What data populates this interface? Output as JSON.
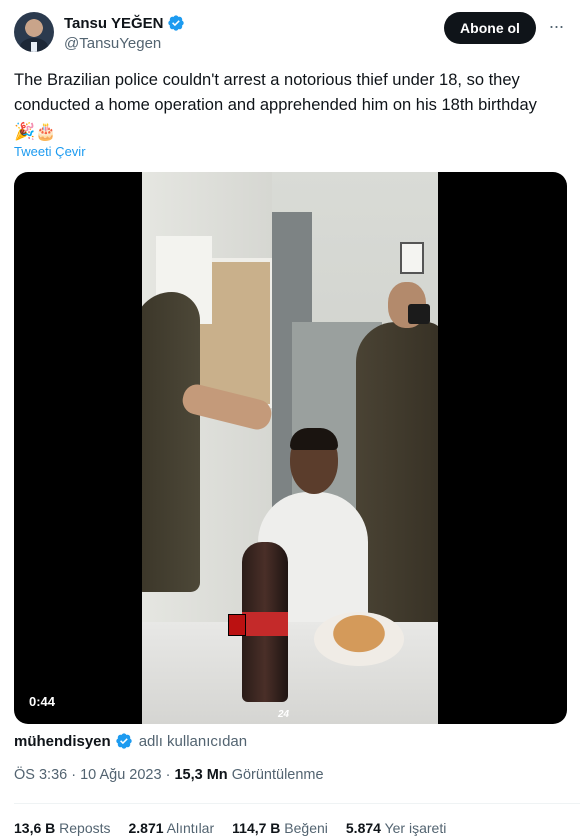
{
  "author": {
    "display_name": "Tansu YEĞEN",
    "handle": "@TansuYegen",
    "verified_color": "#1d9bf0"
  },
  "follow_button": {
    "label": "Abone ol"
  },
  "more_icon": "more-horizontal-icon",
  "tweet": {
    "text": "The Brazilian police couldn't arrest a notorious thief under 18, so they conducted a home operation and apprehended him on his 18th birthday",
    "emojis": [
      "🎉",
      "🎂"
    ]
  },
  "translate_link": "Tweeti Çevir",
  "video": {
    "duration": "0:44",
    "watermark": "24"
  },
  "attribution": {
    "name": "mühendisyen",
    "suffix": "adlı kullanıcıdan"
  },
  "meta": {
    "time": "ÖS 3:36",
    "separator": "·",
    "date": "10 Ağu 2023",
    "views_count": "15,3 Mn",
    "views_label": "Görüntülenme"
  },
  "stats": {
    "reposts_count": "13,6 B",
    "reposts_label": "Reposts",
    "quotes_count": "2.871",
    "quotes_label": "Alıntılar",
    "likes_count": "114,7 B",
    "likes_label": "Beğeni",
    "bookmarks_count": "5.874",
    "bookmarks_label": "Yer işareti"
  },
  "colors": {
    "text": "#0f1419",
    "secondary": "#536471",
    "link": "#1d9bf0",
    "button_bg": "#0f1419"
  }
}
